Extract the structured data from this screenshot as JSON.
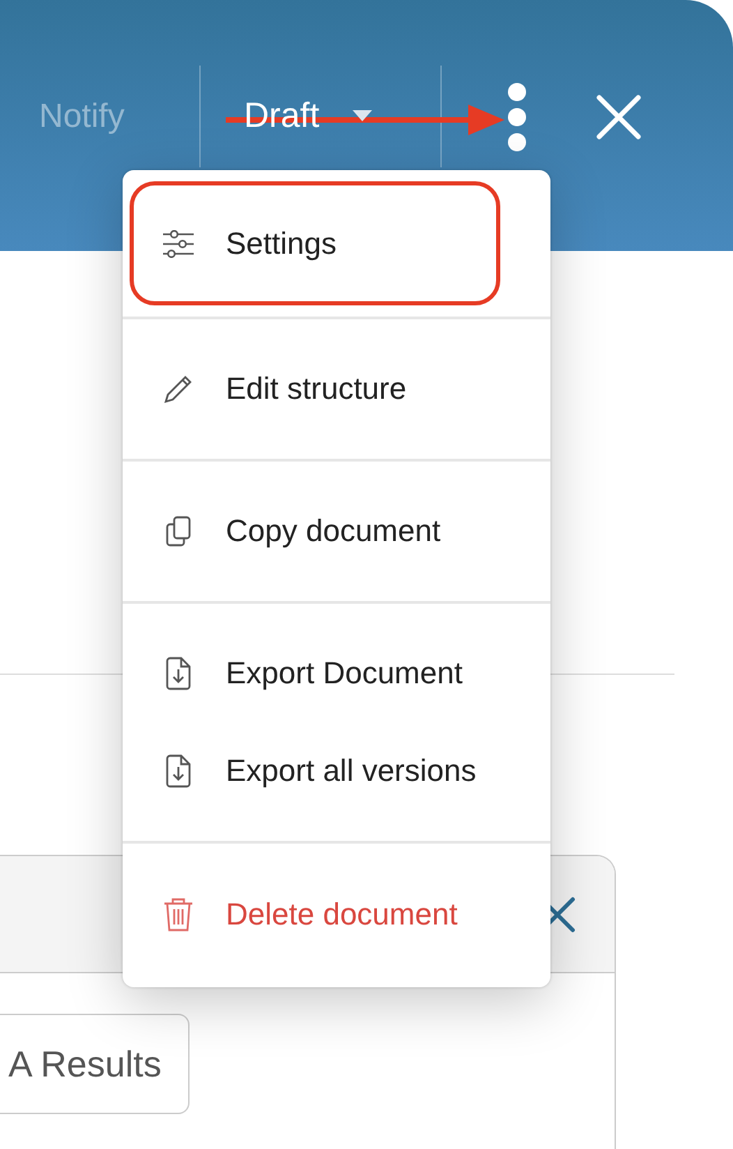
{
  "header": {
    "notify": {
      "label": "Notify",
      "disabled": true
    },
    "status": {
      "label": "Draft"
    },
    "annotation_arrow": true
  },
  "menu": {
    "sections": [
      {
        "items": [
          {
            "label": "Settings",
            "kind": "sliders",
            "danger": false,
            "highlighted": true
          }
        ]
      },
      {
        "items": [
          {
            "label": "Edit structure",
            "kind": "pencil",
            "danger": false,
            "highlighted": false
          }
        ]
      },
      {
        "items": [
          {
            "label": "Copy document",
            "kind": "copy",
            "danger": false,
            "highlighted": false
          }
        ]
      },
      {
        "items": [
          {
            "label": "Export Document",
            "kind": "export",
            "danger": false,
            "highlighted": false
          },
          {
            "label": "Export all versions",
            "kind": "export",
            "danger": false,
            "highlighted": false
          }
        ]
      },
      {
        "items": [
          {
            "label": "Delete document",
            "kind": "trash",
            "danger": true,
            "highlighted": false
          }
        ]
      }
    ]
  },
  "panel": {
    "button": "A Results"
  }
}
